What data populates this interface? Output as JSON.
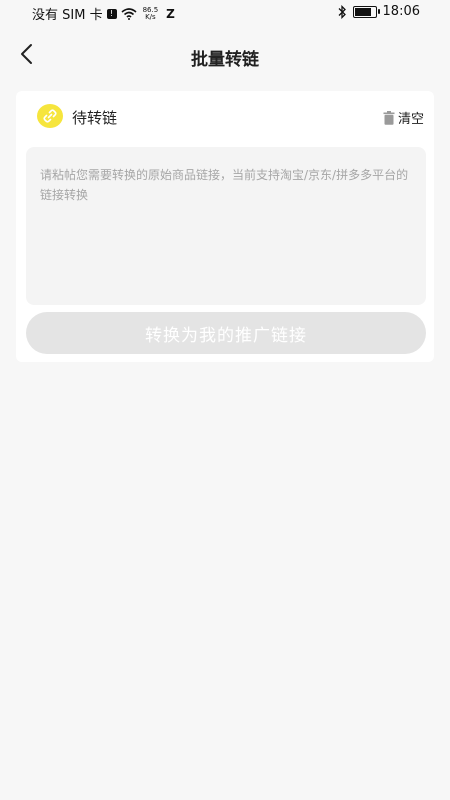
{
  "status_bar": {
    "carrier": "没有 SIM 卡",
    "net_speed_value": "86.5",
    "net_speed_unit": "K/s",
    "app_logo": "Z",
    "time": "18:06",
    "battery_level": 0.85,
    "icons": [
      "sim-alert-icon",
      "wifi-icon",
      "bluetooth-icon",
      "battery-icon"
    ]
  },
  "nav": {
    "title": "批量转链",
    "back_icon": "chevron-left-icon"
  },
  "card": {
    "icon": "link-icon",
    "icon_color": "#f6e53d",
    "title": "待转链",
    "clear_label": "清空",
    "clear_icon": "trash-icon",
    "input_value": "",
    "input_placeholder": "请粘帖您需要转换的原始商品链接，当前支持淘宝/京东/拼多多平台的链接转换",
    "convert_button_label": "转换为我的推广链接",
    "convert_button_color": "#e4e4e4"
  }
}
